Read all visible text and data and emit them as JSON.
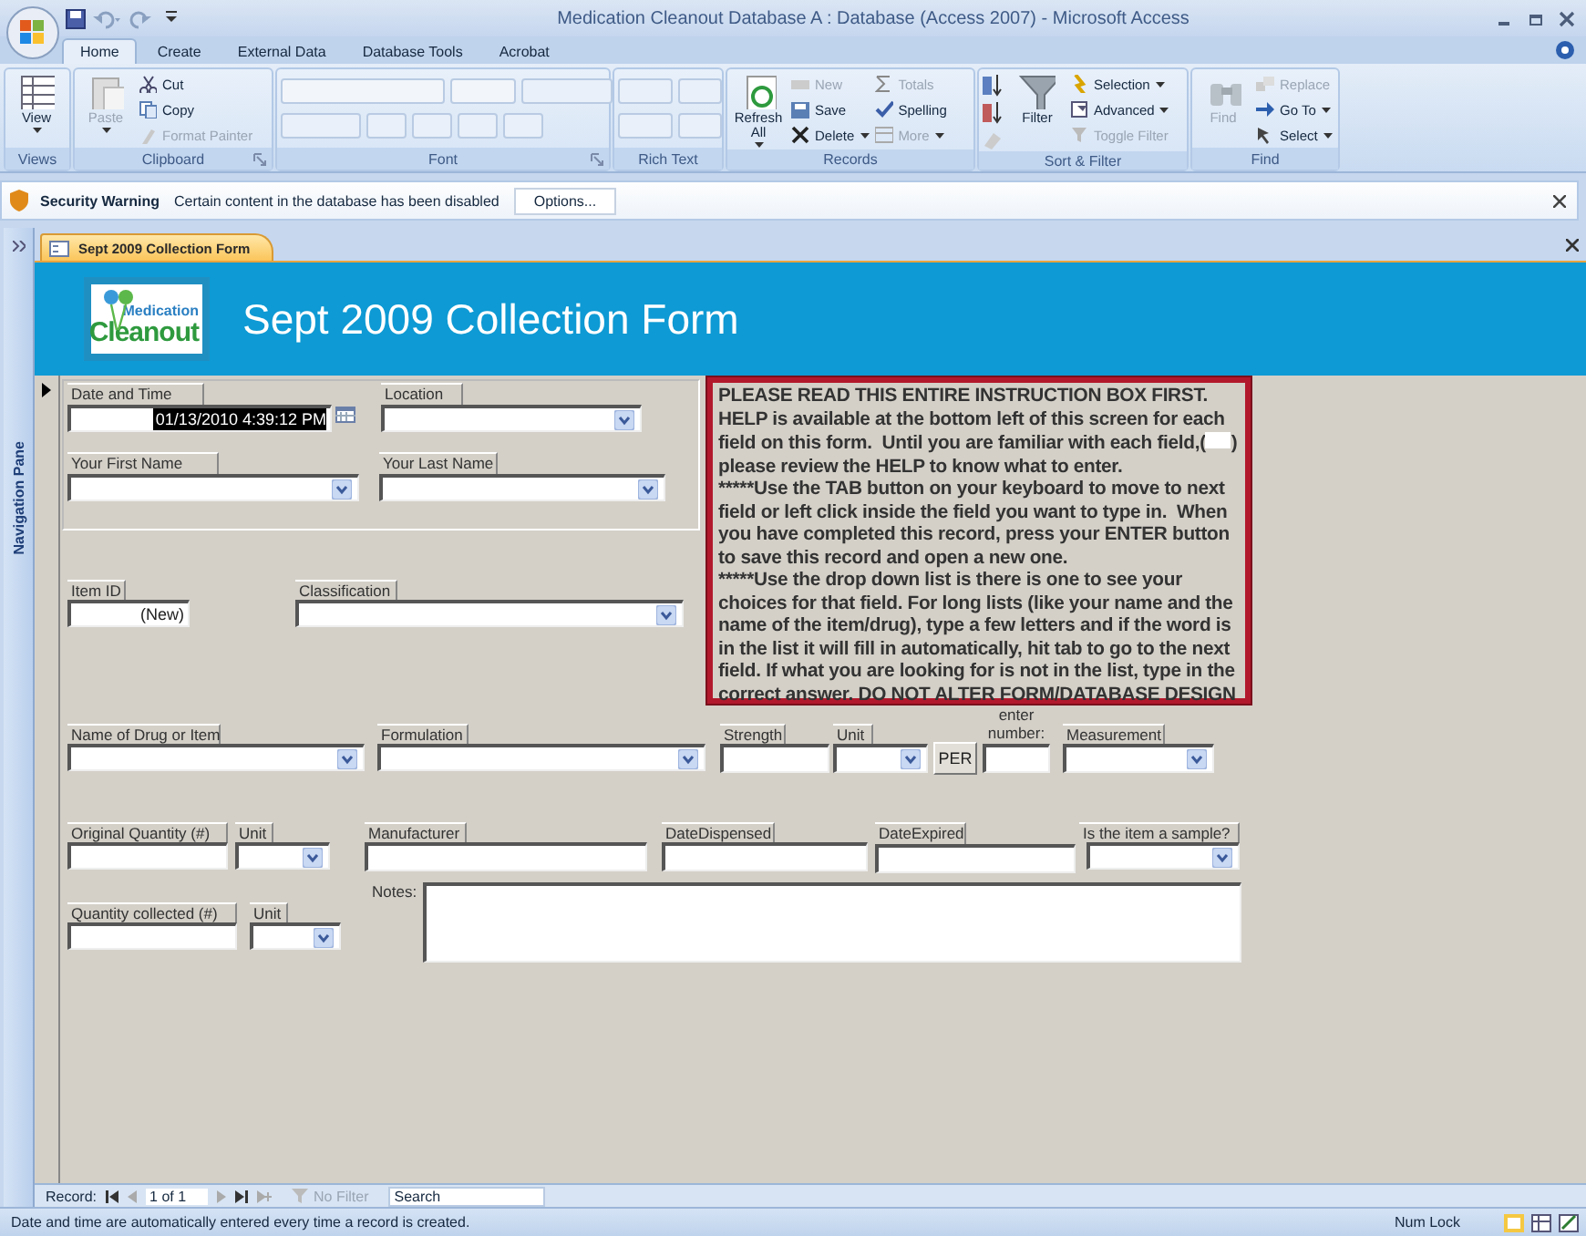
{
  "window": {
    "title": "Medication Cleanout Database A : Database (Access 2007) - Microsoft Access"
  },
  "tabs": [
    {
      "label": "Home",
      "selected": true
    },
    {
      "label": "Create",
      "selected": false
    },
    {
      "label": "External Data",
      "selected": false
    },
    {
      "label": "Database Tools",
      "selected": false
    },
    {
      "label": "Acrobat",
      "selected": false
    }
  ],
  "ribbon": {
    "groups": [
      {
        "label": "Views",
        "launcher": false,
        "items": [
          {
            "kind": "large",
            "label": "View",
            "disabled": false,
            "menu": true
          }
        ]
      },
      {
        "label": "Clipboard",
        "launcher": true,
        "items": [
          {
            "kind": "large",
            "label": "Paste",
            "disabled": true,
            "menu": true
          },
          {
            "kind": "small",
            "label": "Cut",
            "disabled": false,
            "menu": false
          },
          {
            "kind": "small",
            "label": "Copy",
            "disabled": false,
            "menu": false
          },
          {
            "kind": "small",
            "label": "Format Painter",
            "disabled": true,
            "menu": false
          }
        ]
      },
      {
        "label": "Font",
        "launcher": true,
        "items": [
          {
            "kind": "font-tools"
          }
        ]
      },
      {
        "label": "Rich Text",
        "launcher": false,
        "items": [
          {
            "kind": "richtext-tools"
          }
        ]
      },
      {
        "label": "Records",
        "launcher": false,
        "items": [
          {
            "kind": "large",
            "label": "Refresh All",
            "disabled": false,
            "menu": true
          },
          {
            "kind": "small",
            "label": "New",
            "disabled": true,
            "menu": false
          },
          {
            "kind": "small",
            "label": "Save",
            "disabled": false,
            "menu": false
          },
          {
            "kind": "small",
            "label": "Delete",
            "disabled": false,
            "menu": true
          },
          {
            "kind": "small",
            "label": "Totals",
            "disabled": true,
            "menu": false
          },
          {
            "kind": "small",
            "label": "Spelling",
            "disabled": false,
            "menu": false
          },
          {
            "kind": "small",
            "label": "More",
            "disabled": true,
            "menu": true
          }
        ]
      },
      {
        "label": "Sort & Filter",
        "launcher": false,
        "items": [
          {
            "kind": "sort-tools"
          },
          {
            "kind": "large",
            "label": "Filter",
            "disabled": false,
            "menu": false
          },
          {
            "kind": "small",
            "label": "Selection",
            "disabled": false,
            "menu": true
          },
          {
            "kind": "small",
            "label": "Advanced",
            "disabled": false,
            "menu": true
          },
          {
            "kind": "small",
            "label": "Toggle Filter",
            "disabled": true,
            "menu": false
          }
        ]
      },
      {
        "label": "Find",
        "launcher": false,
        "items": [
          {
            "kind": "large",
            "label": "Find",
            "disabled": true,
            "menu": false
          },
          {
            "kind": "small",
            "label": "Replace",
            "disabled": true,
            "menu": false
          },
          {
            "kind": "small",
            "label": "Go To",
            "disabled": false,
            "menu": true
          },
          {
            "kind": "small",
            "label": "Select",
            "disabled": false,
            "menu": true
          }
        ]
      }
    ]
  },
  "security_bar": {
    "title": "Security Warning",
    "message": "Certain content in the database has been disabled",
    "button": "Options..."
  },
  "navigation_pane": {
    "label": "Navigation Pane"
  },
  "document_tab": {
    "label": "Sept 2009 Collection Form"
  },
  "form": {
    "logo_text": [
      "Medication",
      "Cleanout"
    ],
    "title": "Sept 2009 Collection Form",
    "fields": [
      {
        "kind": "date",
        "label": "Date and Time",
        "value": "01/13/2010 4:39:12 PM"
      },
      {
        "kind": "combo",
        "label": "Location"
      },
      {
        "kind": "combo",
        "label": "Your First Name"
      },
      {
        "kind": "combo",
        "label": "Your Last Name"
      },
      {
        "kind": "text",
        "label": "Item ID",
        "value": "(New)"
      },
      {
        "kind": "combo",
        "label": "Classification"
      },
      {
        "kind": "combo",
        "label": "Name of Drug or Item"
      },
      {
        "kind": "combo",
        "label": "Formulation"
      },
      {
        "kind": "text",
        "label": "Strength"
      },
      {
        "kind": "combo",
        "label": "Unit"
      },
      {
        "kind": "button",
        "label": "PER"
      },
      {
        "kind": "text",
        "label": "enter number:"
      },
      {
        "kind": "combo",
        "label": "Measurement"
      },
      {
        "kind": "text",
        "label": "Original Quantity (#)"
      },
      {
        "kind": "combo",
        "label": "Unit"
      },
      {
        "kind": "text",
        "label": "Manufacturer"
      },
      {
        "kind": "text",
        "label": "DateDispensed"
      },
      {
        "kind": "text",
        "label": "DateExpired"
      },
      {
        "kind": "combo",
        "label": "Is the item a sample?"
      },
      {
        "kind": "text",
        "label": "Quantity collected (#)"
      },
      {
        "kind": "combo",
        "label": "Unit"
      },
      {
        "kind": "memo",
        "label": "Notes:"
      }
    ],
    "instructions": [
      {
        "text": "PLEASE READ THIS ENTIRE INSTRUCTION BOX FIRST."
      },
      {
        "text": "HELP is available at the bottom left of this screen for each field on this form.  Until you are familiar with each field,(",
        "after": ") please review the HELP to know what to enter."
      },
      {
        "text": "*****Use the TAB button on your keyboard to move to next field or left click inside the field you want to type in.  When you have completed this record, press your ENTER button to save this record and open a new one."
      },
      {
        "text": "*****Use the drop down list is there is one to see your choices for that field. For long lists (like your name and the name of the item/drug), type a few letters and if the word is in the list it will fill in automatically, hit tab to go to the next field. If what you are looking for is not in the list, type in the correct answer. DO NOT ALTER FORM/DATABASE DESIGN"
      }
    ]
  },
  "record_navigation": {
    "label": "Record:",
    "position": "1 of 1",
    "filter": "No Filter",
    "search": {
      "placeholder": "Search"
    }
  },
  "status_bar": {
    "message": "Date and time are automatically entered every time a record is created.",
    "indicator": "Num Lock"
  }
}
